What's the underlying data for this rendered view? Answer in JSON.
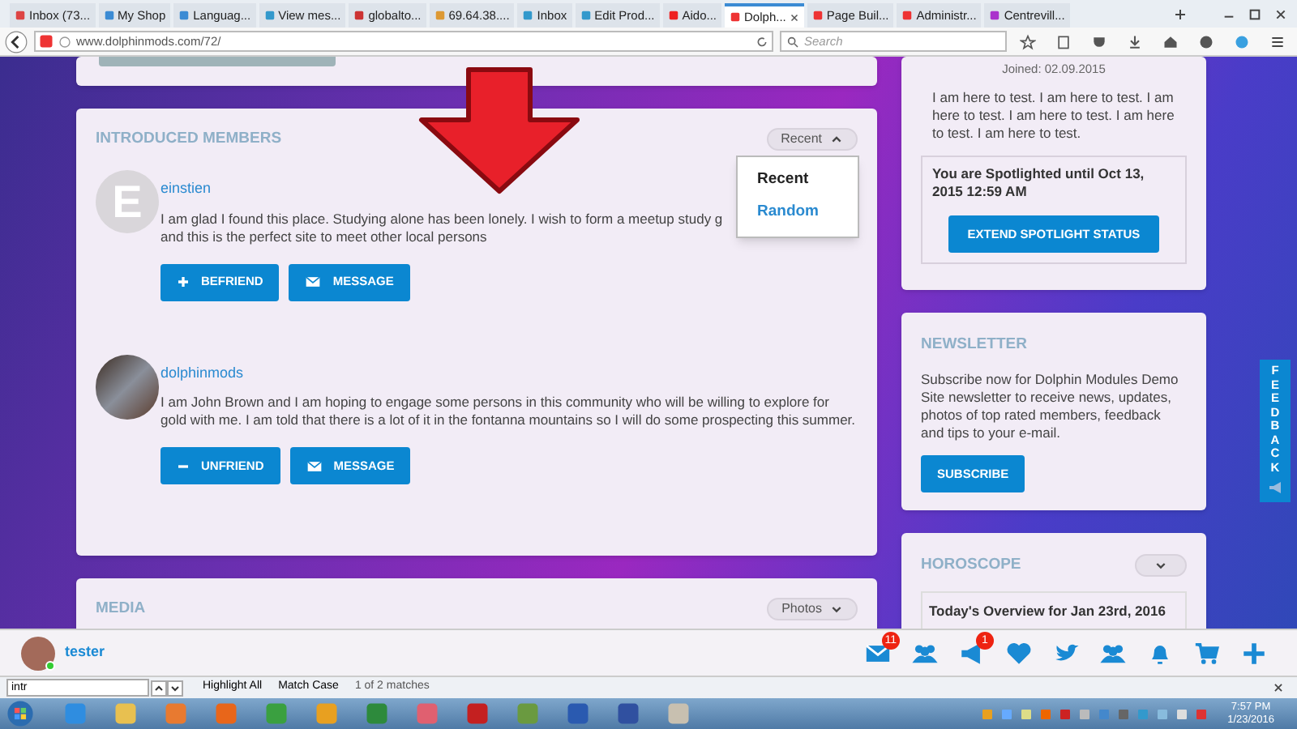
{
  "browser": {
    "tabs": [
      {
        "label": "Inbox (73...",
        "selected": false
      },
      {
        "label": "My Shop",
        "selected": false
      },
      {
        "label": "Languag...",
        "selected": false
      },
      {
        "label": "View mes...",
        "selected": false
      },
      {
        "label": "globalto...",
        "selected": false
      },
      {
        "label": "69.64.38....",
        "selected": false
      },
      {
        "label": "Inbox",
        "selected": false
      },
      {
        "label": "Edit Prod...",
        "selected": false
      },
      {
        "label": "Aido...",
        "selected": false
      },
      {
        "label": "Dolph...",
        "selected": true
      },
      {
        "label": "Page Buil...",
        "selected": false
      },
      {
        "label": "Administr...",
        "selected": false
      },
      {
        "label": "Centrevill...",
        "selected": false
      }
    ],
    "url": "www.dolphinmods.com/72/",
    "search_placeholder": "Search"
  },
  "profile_card": {
    "joined": "Joined: 02.09.2015",
    "about": "I am here to test. I am here to test. I am here to test. I am here to test. I am here to test. I am here to test.",
    "spotlight": "You are Spotlighted until Oct 13, 2015 12:59 AM",
    "button": "EXTEND SPOTLIGHT STATUS"
  },
  "introduced_members": {
    "title": "INTRODUCED MEMBERS",
    "sort": "Recent",
    "sort_menu": [
      {
        "label": "Recent",
        "selected": true
      },
      {
        "label": "Random",
        "selected": false
      }
    ],
    "members": [
      {
        "name": "einstien",
        "avatar_letter": "E",
        "text": "I am glad I found this place. Studying alone has been lonely. I wish to form a meetup study g",
        "text_2": "and this is the perfect site to meet other local persons",
        "is_friend": false,
        "friend_button": "BEFRIEND",
        "message_button": "MESSAGE"
      },
      {
        "name": "dolphinmods",
        "text": "I am John Brown and I am hoping to engage some persons in this community who will be willing to explore for gold with me. I am told that there is a lot of it in the fontanna mountains so I will do some prospecting this summer.",
        "is_friend": true,
        "friend_button": "UNFRIEND",
        "message_button": "MESSAGE"
      }
    ]
  },
  "media": {
    "title": "MEDIA",
    "filter": "Photos"
  },
  "newsletter": {
    "title": "NEWSLETTER",
    "text": "Subscribe now for Dolphin Modules Demo Site newsletter to receive news, updates, photos of top rated members, feedback and tips to your e-mail.",
    "button": "SUBSCRIBE"
  },
  "horoscope": {
    "title": "HOROSCOPE",
    "overview": "Today's Overview for Jan 23rd, 2016"
  },
  "feedback_tab": "FEEDBACK",
  "user_bar": {
    "username": "tester",
    "badges": [
      "11",
      "1"
    ]
  },
  "find_bar": {
    "query": "intr",
    "highlight_all": "Highlight All",
    "match_case": "Match Case",
    "result": "1 of 2 matches"
  },
  "taskbar": {
    "time": "7:57 PM",
    "date": "1/23/2016"
  }
}
